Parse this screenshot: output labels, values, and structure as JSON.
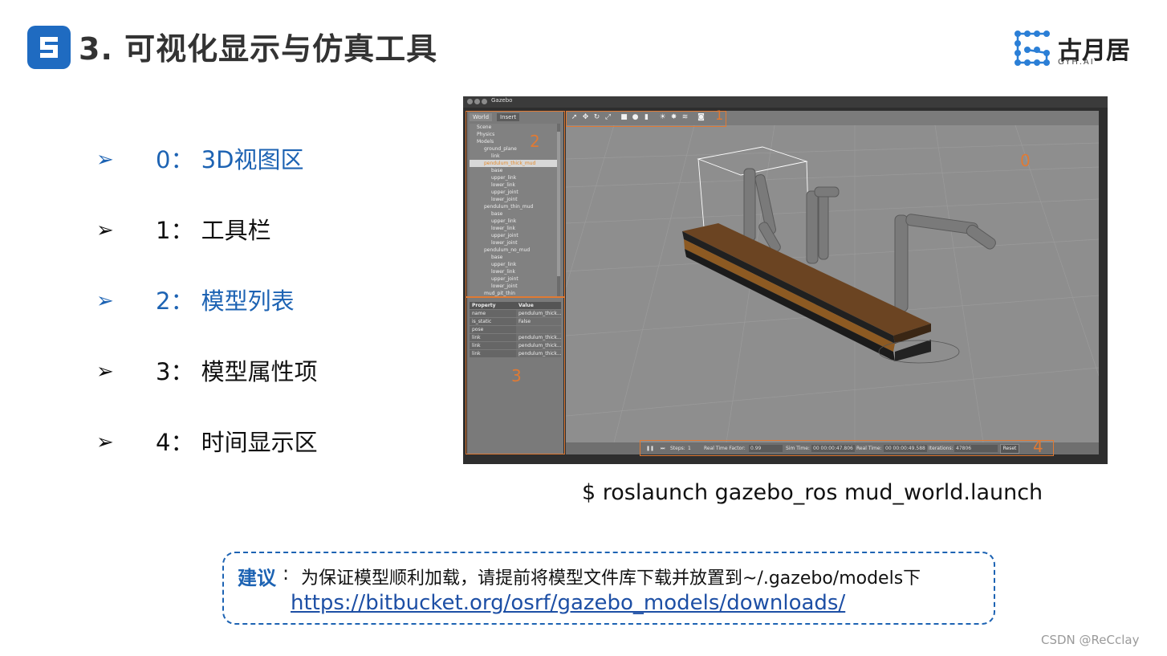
{
  "header": {
    "title": "3. 可视化显示与仿真工具",
    "brand_name": "古月居",
    "brand_sub": "GYH.AI"
  },
  "bullets": [
    {
      "arrow": "➢",
      "text": "0： 3D视图区",
      "color": "#1d63b3"
    },
    {
      "arrow": "➢",
      "text": "1： 工具栏",
      "color": "#111111"
    },
    {
      "arrow": "➢",
      "text": "2： 模型列表",
      "color": "#1d63b3"
    },
    {
      "arrow": "➢",
      "text": "3： 模型属性项",
      "color": "#111111"
    },
    {
      "arrow": "➢",
      "text": "4： 时间显示区",
      "color": "#111111"
    }
  ],
  "gazebo": {
    "window_title": "Gazebo",
    "tabs": [
      "World",
      "Insert"
    ],
    "tree": [
      {
        "label": "Scene",
        "indent": 1,
        "selected": false
      },
      {
        "label": "Physics",
        "indent": 1,
        "selected": false
      },
      {
        "label": "Models",
        "indent": 1,
        "selected": false
      },
      {
        "label": "ground_plane",
        "indent": 2,
        "selected": false
      },
      {
        "label": "link",
        "indent": 3,
        "selected": false
      },
      {
        "label": "pendulum_thick_mud",
        "indent": 2,
        "selected": true
      },
      {
        "label": "base",
        "indent": 3,
        "selected": false
      },
      {
        "label": "upper_link",
        "indent": 3,
        "selected": false
      },
      {
        "label": "lower_link",
        "indent": 3,
        "selected": false
      },
      {
        "label": "upper_joint",
        "indent": 3,
        "selected": false
      },
      {
        "label": "lower_joint",
        "indent": 3,
        "selected": false
      },
      {
        "label": "pendulum_thin_mud",
        "indent": 2,
        "selected": false
      },
      {
        "label": "base",
        "indent": 3,
        "selected": false
      },
      {
        "label": "upper_link",
        "indent": 3,
        "selected": false
      },
      {
        "label": "lower_link",
        "indent": 3,
        "selected": false
      },
      {
        "label": "upper_joint",
        "indent": 3,
        "selected": false
      },
      {
        "label": "lower_joint",
        "indent": 3,
        "selected": false
      },
      {
        "label": "pendulum_no_mud",
        "indent": 2,
        "selected": false
      },
      {
        "label": "base",
        "indent": 3,
        "selected": false
      },
      {
        "label": "upper_link",
        "indent": 3,
        "selected": false
      },
      {
        "label": "lower_link",
        "indent": 3,
        "selected": false
      },
      {
        "label": "upper_joint",
        "indent": 3,
        "selected": false
      },
      {
        "label": "lower_joint",
        "indent": 3,
        "selected": false
      },
      {
        "label": "mud_pit_thin",
        "indent": 2,
        "selected": false
      }
    ],
    "properties": {
      "header": {
        "key": "Property",
        "value": "Value"
      },
      "rows": [
        {
          "key": "name",
          "value": "pendulum_thick..."
        },
        {
          "key": "is_static",
          "value": "False"
        },
        {
          "key": "pose",
          "value": ""
        },
        {
          "key": "link",
          "value": "pendulum_thick..."
        },
        {
          "key": "link",
          "value": "pendulum_thick..."
        },
        {
          "key": "link",
          "value": "pendulum_thick..."
        }
      ]
    },
    "toolbar_icons": [
      "select-icon",
      "translate-icon",
      "rotate-icon",
      "scale-icon",
      "box-icon",
      "sphere-icon",
      "cylinder-icon",
      "sun-icon",
      "spotlight-icon",
      "directional-light-icon",
      "camera-icon"
    ],
    "timebar": {
      "steps_label": "Steps:",
      "steps_value": "1",
      "rtf_label": "Real Time Factor:",
      "rtf_value": "0.99",
      "sim_time_label": "Sim Time:",
      "sim_time_value": "00 00:00:47.806",
      "real_time_label": "Real Time:",
      "real_time_value": "00 00:00:49.588",
      "iterations_label": "Iterations:",
      "iterations_value": "47806",
      "reset_label": "Reset"
    },
    "zone_labels": [
      "0",
      "1",
      "2",
      "3",
      "4"
    ],
    "colors": {
      "zone": "#e07a34",
      "selected_text": "#e38a2c"
    }
  },
  "command": "$ roslaunch gazebo_ros mud_world.launch",
  "tip": {
    "label": "建议",
    "colon": ":",
    "text": "为保证模型顺利加载，请提前将模型文件库下载并放置到~/.gazebo/models下",
    "link": "https://bitbucket.org/osrf/gazebo_models/downloads/"
  },
  "watermark": "CSDN @ReCclay",
  "accent_color": "#1d63b3"
}
